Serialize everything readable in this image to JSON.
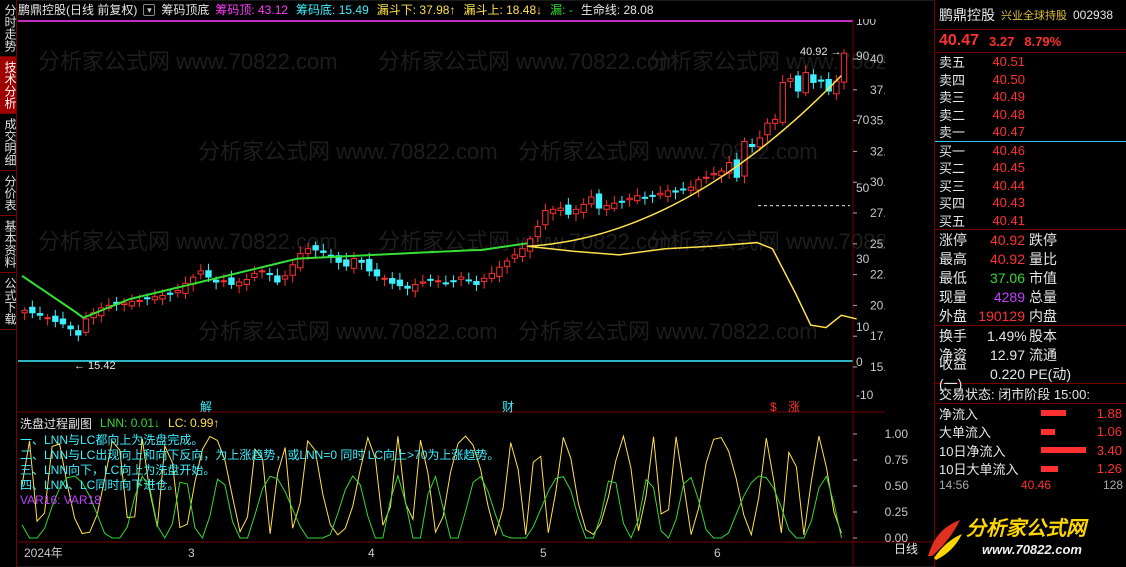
{
  "tabs": [
    {
      "label": "分时走势",
      "active": false
    },
    {
      "label": "技术分析",
      "active": true
    },
    {
      "label": "成交明细",
      "active": false
    },
    {
      "label": "分价表",
      "active": false
    },
    {
      "label": "基本资料",
      "active": false
    },
    {
      "label": "公式下载",
      "active": false
    }
  ],
  "header": {
    "title": "鹏鼎控股(日线 前复权)",
    "indicator": "筹码顶底",
    "items": [
      {
        "label": "筹码顶: 43.12",
        "color": "#ff3cff"
      },
      {
        "label": "筹码底: 15.49",
        "color": "#3cf0ff"
      },
      {
        "label": "漏斗下: 37.98↑",
        "color": "#ffe14a"
      },
      {
        "label": "漏斗上: 18.48↓",
        "color": "#ffe14a"
      },
      {
        "label": "漏: -",
        "color": "#34d834"
      },
      {
        "label": "生命线: 28.08",
        "color": "#e6e6e6"
      }
    ]
  },
  "main_axis": {
    "price_ticks": [
      "40.00",
      "37.50",
      "35.00",
      "32.50",
      "30.00",
      "27.50",
      "25.00",
      "22.50",
      "20.00",
      "17.50",
      "15.00"
    ],
    "pct_ticks": [
      "100",
      "90",
      "70",
      "50",
      "30",
      "10",
      "0",
      "-10"
    ],
    "annotations": {
      "high_label": "40.92",
      "low_label": "15.42"
    },
    "event_markers": [
      "解",
      "财",
      "$",
      "涨"
    ]
  },
  "sub_chart": {
    "title": "洗盘过程副图",
    "lnn": "LNN: 0.01↓",
    "lc": "LC: 0.99↑",
    "notes": [
      "一、LNN与LC都向上为洗盘完成。",
      "二、LNN与LC出现向上和向下反向，为上涨趋势，或LNN=0 同时 LC向上>70为上涨趋势。",
      "三、LNN向下，LC向上为洗盘开始。",
      "四、LNN、LC同时向下进仓。"
    ],
    "var_label": "VAR16: VAR18",
    "ticks": [
      "1.00",
      "0.75",
      "0.50",
      "0.25",
      "0.00"
    ],
    "x_labels": [
      "2024年",
      "3",
      "4",
      "5",
      "6"
    ],
    "corner_label": "日线"
  },
  "quote": {
    "name": "鹏鼎控股",
    "tag": "兴业全球持股",
    "code": "002938",
    "price": "40.47",
    "change": "3.27",
    "change_pct": "8.79%",
    "asks": [
      {
        "label": "卖五",
        "price": "40.51"
      },
      {
        "label": "卖四",
        "price": "40.50"
      },
      {
        "label": "卖三",
        "price": "40.49"
      },
      {
        "label": "卖二",
        "price": "40.48"
      },
      {
        "label": "卖一",
        "price": "40.47"
      }
    ],
    "bids": [
      {
        "label": "买一",
        "price": "40.46"
      },
      {
        "label": "买二",
        "price": "40.45"
      },
      {
        "label": "买三",
        "price": "40.44"
      },
      {
        "label": "买四",
        "price": "40.43"
      },
      {
        "label": "买五",
        "price": "40.41"
      }
    ],
    "stats": [
      {
        "label": "涨停",
        "value": "40.92",
        "color": "#ff3030",
        "label2": "跌停"
      },
      {
        "label": "最高",
        "value": "40.92",
        "color": "#ff3030",
        "label2": "量比"
      },
      {
        "label": "最低",
        "value": "37.06",
        "color": "#34d834",
        "label2": "市值"
      },
      {
        "label": "现量",
        "value": "4289",
        "color": "#c040ff",
        "label2": "总量"
      },
      {
        "label": "外盘",
        "value": "190129",
        "color": "#ff3030",
        "label2": "内盘"
      }
    ],
    "stats2": [
      {
        "label": "换手",
        "value": "1.49%",
        "label2": "股本"
      },
      {
        "label": "净资",
        "value": "12.97",
        "label2": "流通"
      },
      {
        "label": "收益(一)",
        "value": "0.220",
        "label2": "PE(动)"
      }
    ],
    "trade_status": "交易状态: 闭市阶段  15:00:",
    "flows": [
      {
        "label": "净流入",
        "value": "1.88",
        "bar": 0.25
      },
      {
        "label": "大单流入",
        "value": "1.06",
        "bar": 0.14
      },
      {
        "label": "10日净流入",
        "value": "3.40",
        "bar": 0.45
      },
      {
        "label": "10日大单流入",
        "value": "1.26",
        "bar": 0.17
      }
    ],
    "tick_row": {
      "time": "14:56",
      "price": "40.46",
      "vol": "128"
    }
  },
  "logo": {
    "line1": "分析家公式网",
    "line2": "www.70822.com"
  },
  "watermark": "分析家公式网 www.70822.com"
}
